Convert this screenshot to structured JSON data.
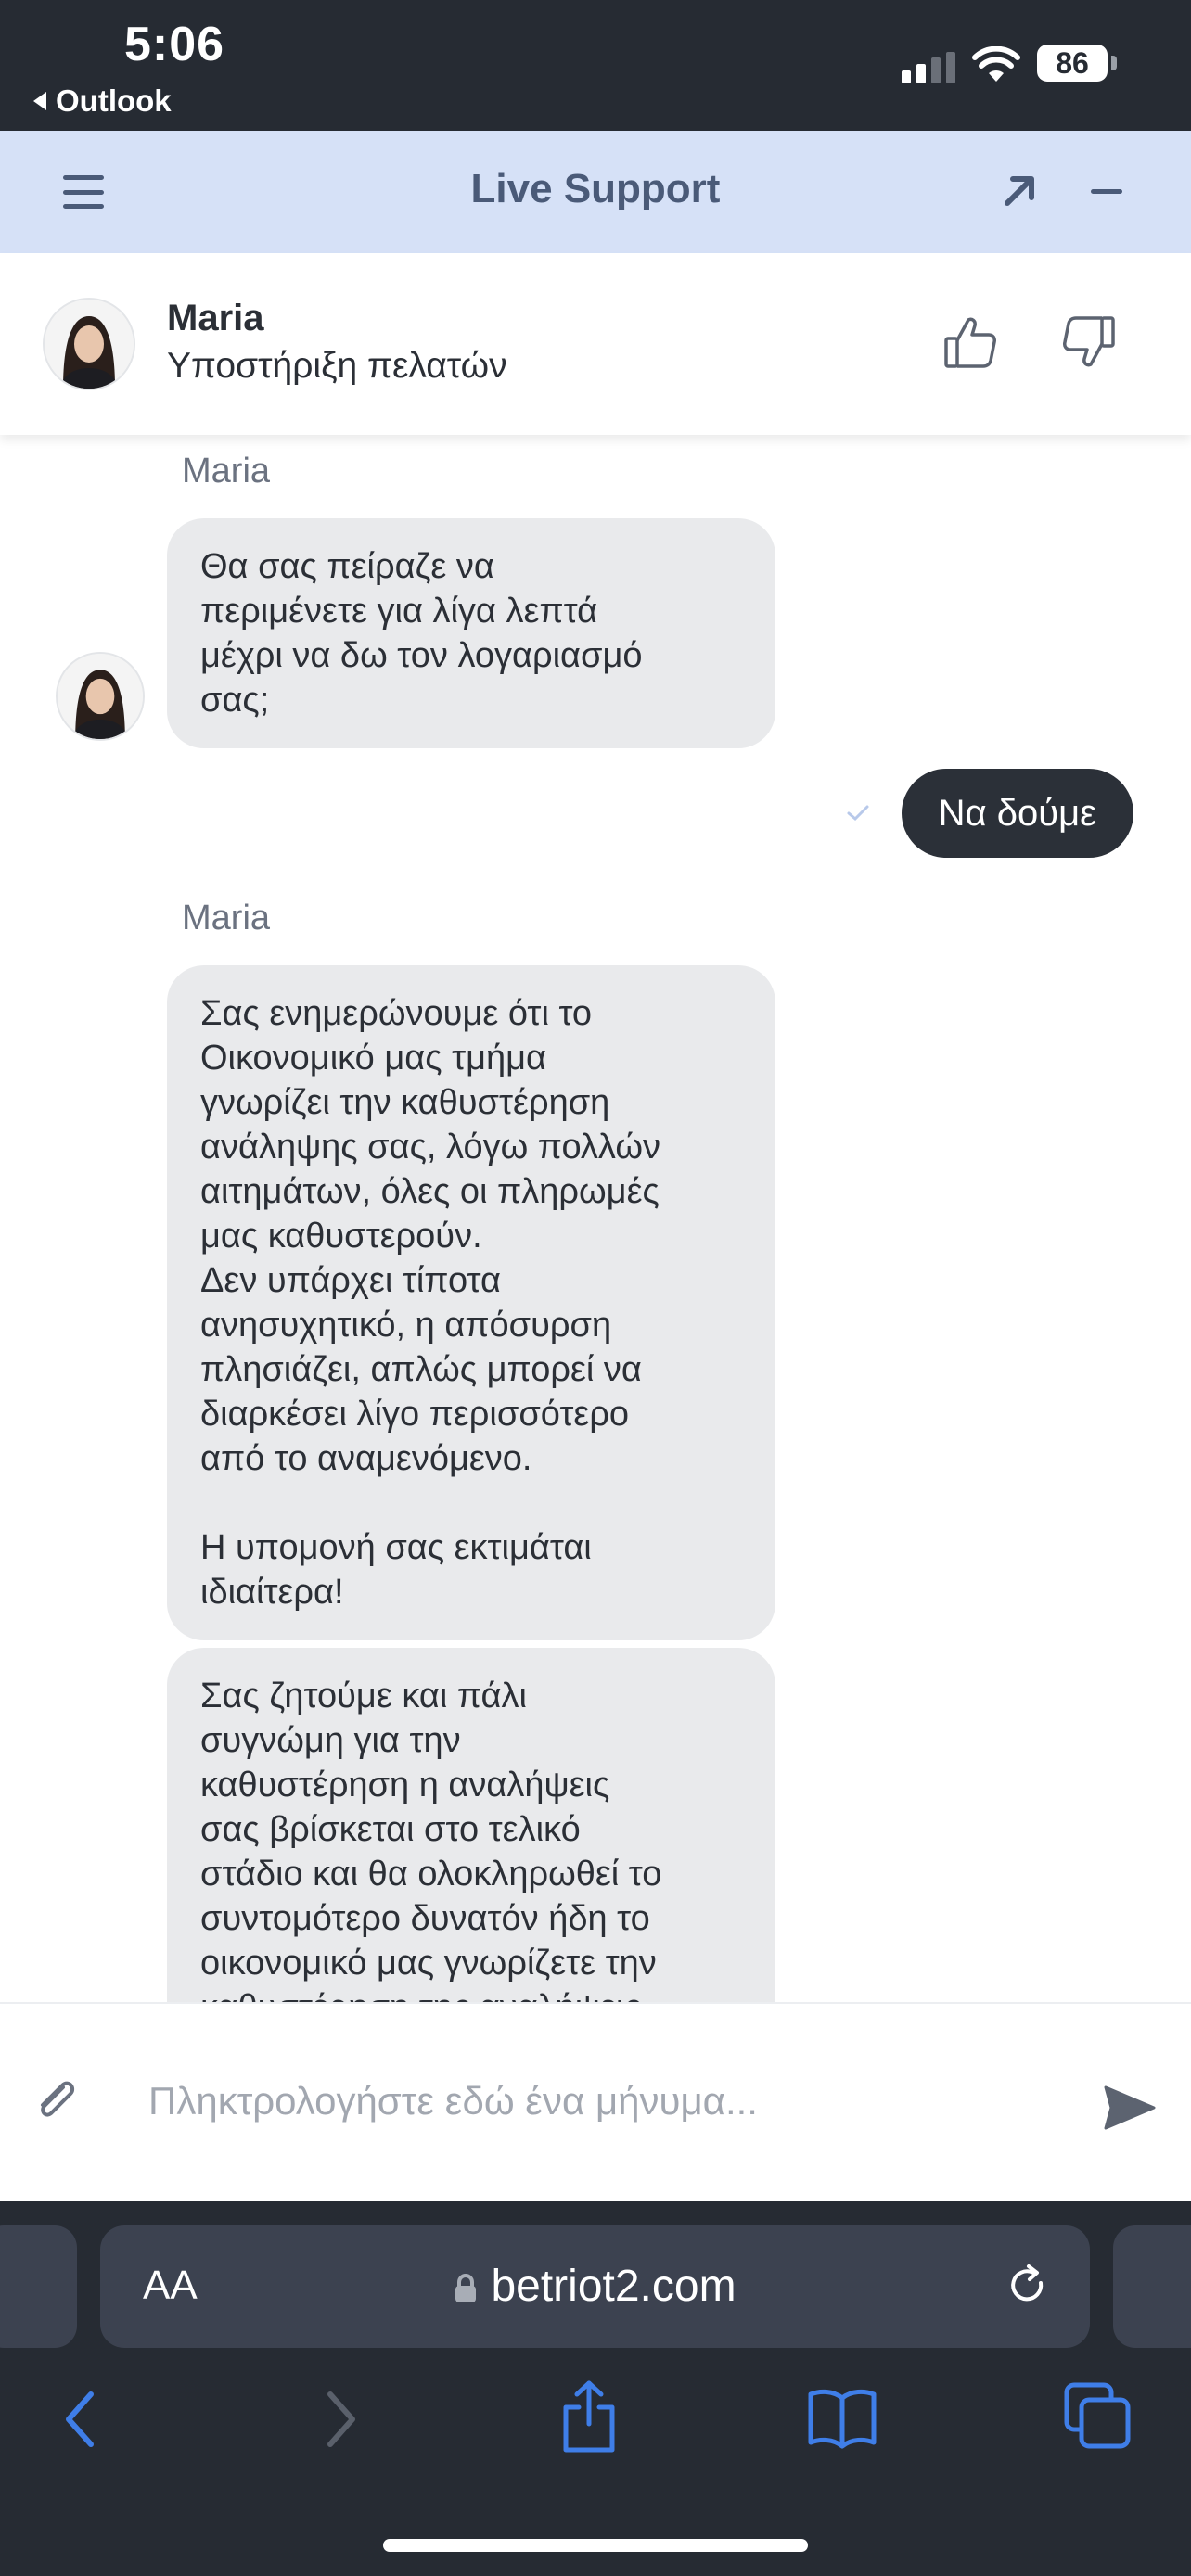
{
  "status_bar": {
    "time": "5:06",
    "back_app": "Outlook",
    "battery": "86"
  },
  "header": {
    "title": "Live Support"
  },
  "agent": {
    "name": "Maria",
    "role": "Υποστήριξη πελατών"
  },
  "messages": [
    {
      "type": "sender",
      "text": "Maria"
    },
    {
      "type": "incoming",
      "text": "Θα σας πείραζε να\nπεριμένετε για λίγα λεπτά\nμέχρι να δω τον λογαριασμό\nσας;"
    },
    {
      "type": "outgoing",
      "text": "Να δούμε"
    },
    {
      "type": "sender",
      "text": "Maria"
    },
    {
      "type": "incoming",
      "text": "Σας ενημερώνουμε ότι το\nΟικονομικό μας τμήμα\nγνωρίζει την καθυστέρηση\nανάληψης σας, λόγω πολλών\nαιτημάτων, όλες οι πληρωμές\nμας καθυστερούν.\nΔεν υπάρχει τίποτα\nανησυχητικό, η απόσυρση\nπλησιάζει, απλώς μπορεί να\nδιαρκέσει λίγο περισσότερο\nαπό το αναμενόμενο.\n\nΗ υπομονή σας εκτιμάται\nιδιαίτερα!"
    },
    {
      "type": "incoming",
      "text": "Σας ζητούμε και πάλι\nσυγνώμη για την\nκαθυστέρηση η αναλήψεις\nσας βρίσκεται στο τελικό\nστάδιο και θα ολοκληρωθεί το\nσυντομότερο δυνατόν ήδη το\nοικονομικό μας γνωρίζετε την\nκαθυστέρηση της αναλήψεις"
    }
  ],
  "composer": {
    "placeholder": "Πληκτρολογήστε εδώ ένα μήνυμα..."
  },
  "browser": {
    "text_size_label": "AA",
    "url": "betriot2.com"
  },
  "icons": {
    "menu": "hamburger-icon",
    "expand": "arrow-up-right-icon",
    "minimize": "minus-icon",
    "like": "thumbs-up-icon",
    "dislike": "thumbs-down-icon",
    "attach": "paperclip-icon",
    "send": "paper-plane-icon",
    "lock": "lock-icon",
    "reload": "reload-icon",
    "back": "chevron-left-icon",
    "forward": "chevron-right-icon",
    "share": "share-icon",
    "bookmarks": "book-icon",
    "tabs": "tabs-icon"
  },
  "colors": {
    "header_bg": "#d6e1f7",
    "header_text": "#4a5a78",
    "incoming_bubble": "#e9eaec",
    "outgoing_bubble": "#2b3038",
    "system_dark": "#262b33",
    "browser_accent": "#3f7ee8"
  }
}
